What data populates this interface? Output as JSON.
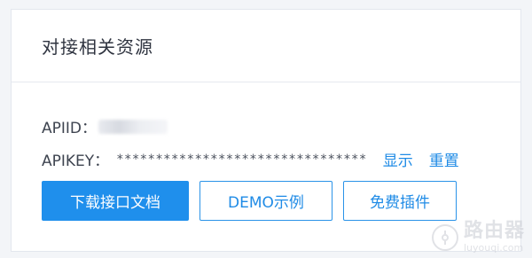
{
  "section": {
    "title": "对接相关资源"
  },
  "credentials": {
    "apiid_label": "APIID：",
    "apikey_label": "APIKEY：",
    "apikey_value": "********************************",
    "show_label": "显示",
    "reset_label": "重置"
  },
  "actions": {
    "download_docs_label": "下载接口文档",
    "demo_label": "DEMO示例",
    "free_plugin_label": "免费插件"
  },
  "watermark": {
    "brand_cn": "路由器",
    "brand_en": "luyouqi.com"
  },
  "colors": {
    "accent": "#1f8fec",
    "link": "#1f8be6"
  }
}
